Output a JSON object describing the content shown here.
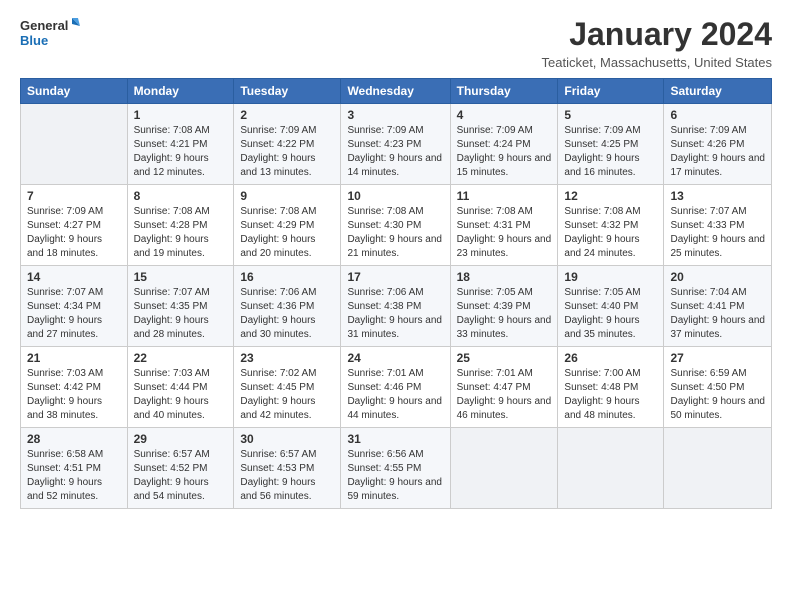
{
  "logo": {
    "line1": "General",
    "line2": "Blue"
  },
  "title": "January 2024",
  "location": "Teaticket, Massachusetts, United States",
  "weekdays": [
    "Sunday",
    "Monday",
    "Tuesday",
    "Wednesday",
    "Thursday",
    "Friday",
    "Saturday"
  ],
  "weeks": [
    [
      {
        "day": "",
        "sunrise": "",
        "sunset": "",
        "daylight": ""
      },
      {
        "day": "1",
        "sunrise": "Sunrise: 7:08 AM",
        "sunset": "Sunset: 4:21 PM",
        "daylight": "Daylight: 9 hours and 12 minutes."
      },
      {
        "day": "2",
        "sunrise": "Sunrise: 7:09 AM",
        "sunset": "Sunset: 4:22 PM",
        "daylight": "Daylight: 9 hours and 13 minutes."
      },
      {
        "day": "3",
        "sunrise": "Sunrise: 7:09 AM",
        "sunset": "Sunset: 4:23 PM",
        "daylight": "Daylight: 9 hours and 14 minutes."
      },
      {
        "day": "4",
        "sunrise": "Sunrise: 7:09 AM",
        "sunset": "Sunset: 4:24 PM",
        "daylight": "Daylight: 9 hours and 15 minutes."
      },
      {
        "day": "5",
        "sunrise": "Sunrise: 7:09 AM",
        "sunset": "Sunset: 4:25 PM",
        "daylight": "Daylight: 9 hours and 16 minutes."
      },
      {
        "day": "6",
        "sunrise": "Sunrise: 7:09 AM",
        "sunset": "Sunset: 4:26 PM",
        "daylight": "Daylight: 9 hours and 17 minutes."
      }
    ],
    [
      {
        "day": "7",
        "sunrise": "Sunrise: 7:09 AM",
        "sunset": "Sunset: 4:27 PM",
        "daylight": "Daylight: 9 hours and 18 minutes."
      },
      {
        "day": "8",
        "sunrise": "Sunrise: 7:08 AM",
        "sunset": "Sunset: 4:28 PM",
        "daylight": "Daylight: 9 hours and 19 minutes."
      },
      {
        "day": "9",
        "sunrise": "Sunrise: 7:08 AM",
        "sunset": "Sunset: 4:29 PM",
        "daylight": "Daylight: 9 hours and 20 minutes."
      },
      {
        "day": "10",
        "sunrise": "Sunrise: 7:08 AM",
        "sunset": "Sunset: 4:30 PM",
        "daylight": "Daylight: 9 hours and 21 minutes."
      },
      {
        "day": "11",
        "sunrise": "Sunrise: 7:08 AM",
        "sunset": "Sunset: 4:31 PM",
        "daylight": "Daylight: 9 hours and 23 minutes."
      },
      {
        "day": "12",
        "sunrise": "Sunrise: 7:08 AM",
        "sunset": "Sunset: 4:32 PM",
        "daylight": "Daylight: 9 hours and 24 minutes."
      },
      {
        "day": "13",
        "sunrise": "Sunrise: 7:07 AM",
        "sunset": "Sunset: 4:33 PM",
        "daylight": "Daylight: 9 hours and 25 minutes."
      }
    ],
    [
      {
        "day": "14",
        "sunrise": "Sunrise: 7:07 AM",
        "sunset": "Sunset: 4:34 PM",
        "daylight": "Daylight: 9 hours and 27 minutes."
      },
      {
        "day": "15",
        "sunrise": "Sunrise: 7:07 AM",
        "sunset": "Sunset: 4:35 PM",
        "daylight": "Daylight: 9 hours and 28 minutes."
      },
      {
        "day": "16",
        "sunrise": "Sunrise: 7:06 AM",
        "sunset": "Sunset: 4:36 PM",
        "daylight": "Daylight: 9 hours and 30 minutes."
      },
      {
        "day": "17",
        "sunrise": "Sunrise: 7:06 AM",
        "sunset": "Sunset: 4:38 PM",
        "daylight": "Daylight: 9 hours and 31 minutes."
      },
      {
        "day": "18",
        "sunrise": "Sunrise: 7:05 AM",
        "sunset": "Sunset: 4:39 PM",
        "daylight": "Daylight: 9 hours and 33 minutes."
      },
      {
        "day": "19",
        "sunrise": "Sunrise: 7:05 AM",
        "sunset": "Sunset: 4:40 PM",
        "daylight": "Daylight: 9 hours and 35 minutes."
      },
      {
        "day": "20",
        "sunrise": "Sunrise: 7:04 AM",
        "sunset": "Sunset: 4:41 PM",
        "daylight": "Daylight: 9 hours and 37 minutes."
      }
    ],
    [
      {
        "day": "21",
        "sunrise": "Sunrise: 7:03 AM",
        "sunset": "Sunset: 4:42 PM",
        "daylight": "Daylight: 9 hours and 38 minutes."
      },
      {
        "day": "22",
        "sunrise": "Sunrise: 7:03 AM",
        "sunset": "Sunset: 4:44 PM",
        "daylight": "Daylight: 9 hours and 40 minutes."
      },
      {
        "day": "23",
        "sunrise": "Sunrise: 7:02 AM",
        "sunset": "Sunset: 4:45 PM",
        "daylight": "Daylight: 9 hours and 42 minutes."
      },
      {
        "day": "24",
        "sunrise": "Sunrise: 7:01 AM",
        "sunset": "Sunset: 4:46 PM",
        "daylight": "Daylight: 9 hours and 44 minutes."
      },
      {
        "day": "25",
        "sunrise": "Sunrise: 7:01 AM",
        "sunset": "Sunset: 4:47 PM",
        "daylight": "Daylight: 9 hours and 46 minutes."
      },
      {
        "day": "26",
        "sunrise": "Sunrise: 7:00 AM",
        "sunset": "Sunset: 4:48 PM",
        "daylight": "Daylight: 9 hours and 48 minutes."
      },
      {
        "day": "27",
        "sunrise": "Sunrise: 6:59 AM",
        "sunset": "Sunset: 4:50 PM",
        "daylight": "Daylight: 9 hours and 50 minutes."
      }
    ],
    [
      {
        "day": "28",
        "sunrise": "Sunrise: 6:58 AM",
        "sunset": "Sunset: 4:51 PM",
        "daylight": "Daylight: 9 hours and 52 minutes."
      },
      {
        "day": "29",
        "sunrise": "Sunrise: 6:57 AM",
        "sunset": "Sunset: 4:52 PM",
        "daylight": "Daylight: 9 hours and 54 minutes."
      },
      {
        "day": "30",
        "sunrise": "Sunrise: 6:57 AM",
        "sunset": "Sunset: 4:53 PM",
        "daylight": "Daylight: 9 hours and 56 minutes."
      },
      {
        "day": "31",
        "sunrise": "Sunrise: 6:56 AM",
        "sunset": "Sunset: 4:55 PM",
        "daylight": "Daylight: 9 hours and 59 minutes."
      },
      {
        "day": "",
        "sunrise": "",
        "sunset": "",
        "daylight": ""
      },
      {
        "day": "",
        "sunrise": "",
        "sunset": "",
        "daylight": ""
      },
      {
        "day": "",
        "sunrise": "",
        "sunset": "",
        "daylight": ""
      }
    ]
  ]
}
